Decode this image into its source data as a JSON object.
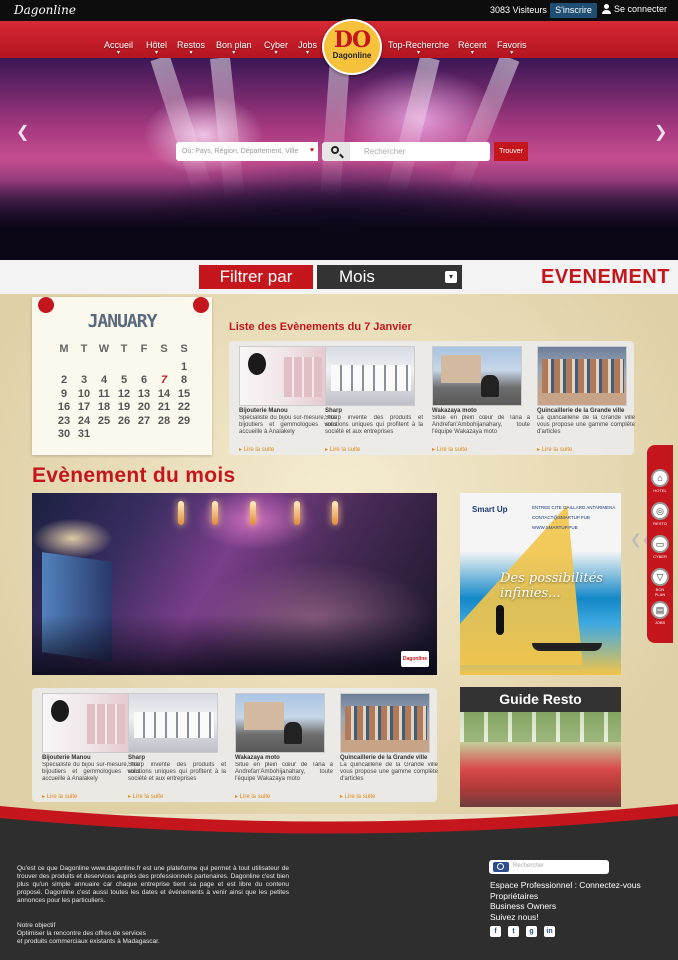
{
  "topbar": {
    "logo": "Dagonline",
    "visitors": "3083 Visiteurs",
    "signup": "S'inscrire",
    "login": "Se connecter"
  },
  "nav": {
    "items": [
      "Accueil",
      "Hôtel",
      "Restos",
      "Bon plan",
      "Cyber",
      "Jobs",
      "Top-Recherche",
      "Récent",
      "Favoris"
    ],
    "logo_mark": "DO",
    "logo_text": "Dagonline"
  },
  "search": {
    "where_placeholder": "Où: Pays, Région, Département, Ville",
    "what_placeholder": "Rechercher",
    "submit": "Trouver"
  },
  "filter": {
    "label": "Filtrer par",
    "selected": "Mois",
    "section_title": "EVENEMENT"
  },
  "calendar": {
    "month": "JANUARY",
    "weekdays": [
      "M",
      "T",
      "W",
      "T",
      "F",
      "S",
      "S"
    ],
    "leading_blanks": 6,
    "days": 31,
    "today": 7
  },
  "events_list": {
    "title": "Liste des Evènements du 7 Janvier",
    "read_more": "Lire la suite",
    "cards": [
      {
        "name": "Bijouterie Manou",
        "desc": "Spécialiste du bijou sur-mesure, nos bijoutiers et gemmologues vous accueille à Analakely",
        "image": "jewelry-shop"
      },
      {
        "name": "Sharp",
        "desc": "Sharp invente des produits et solutions uniques qui profitent à la société et aux entreprises",
        "image": "electronics-store"
      },
      {
        "name": "Wakazaya moto",
        "desc": "Situé en plein cœur de Tana à Andrefan'Ambohijanahary, toute l'équipe Wakazaya moto",
        "image": "motorbike"
      },
      {
        "name": "Quincaillerie de la Grande ville",
        "desc": "La quincaillerie de la Grande ville vous propose une gamme complète d'articles",
        "image": "hardware-store"
      }
    ]
  },
  "event_month": {
    "title": "Evènement du mois",
    "photo_tag": "Dagonline"
  },
  "ad": {
    "logo": "Smart Up",
    "contacts": [
      "ENTREE CITE GAILLARD ANTARIMENA",
      "CONTACT@SMARTUP.PUB",
      "WWW.SMARTUP.PUB"
    ],
    "tagline": "Des possibilités infinies..."
  },
  "side_tabs": [
    {
      "label": "HOTEL",
      "icon": "home-icon",
      "glyph": "⌂"
    },
    {
      "label": "RESTO",
      "icon": "plate-icon",
      "glyph": "◎"
    },
    {
      "label": "CYBER",
      "icon": "computer-icon",
      "glyph": "▭"
    },
    {
      "label": "BON PLAN",
      "icon": "cocktail-icon",
      "glyph": "▽"
    },
    {
      "label": "JOBS",
      "icon": "briefcase-icon",
      "glyph": "▤"
    }
  ],
  "guide_resto": {
    "title": "Guide Resto"
  },
  "footer": {
    "about": "Qu'est ce que Dagonline www.dagonline.fr est une plateforme qui permet à tout utilisateur de trouver des produits et deservices auprès des professionnels partenaires. Dagonline c'est bien plus qu'un simple annuaire car chaque entreprise tient sa page et est libre du contenu proposé. Dagonline c'est aussi toutes les dates et événements à venir ainsi que les petites annonces pour les particuliers.",
    "objective_title": "Notre objectif",
    "objective_lines": [
      "Optimiser la rencontre des offres de services",
      "et produits commerciaux existants à Madagascar."
    ],
    "search_placeholder": "Rechercher",
    "links": [
      "Espace Professionnel : Connectez-vous",
      "Propriétaires",
      "Business Owners",
      "Suivez nous!"
    ],
    "social": [
      "facebook-icon",
      "twitter-icon",
      "googleplus-icon",
      "linkedin-icon"
    ]
  },
  "colors": {
    "brand_red": "#c4161c",
    "dark": "#2e2e2e",
    "accent_orange": "#e08a1c",
    "signup_blue": "#1e4f72"
  }
}
